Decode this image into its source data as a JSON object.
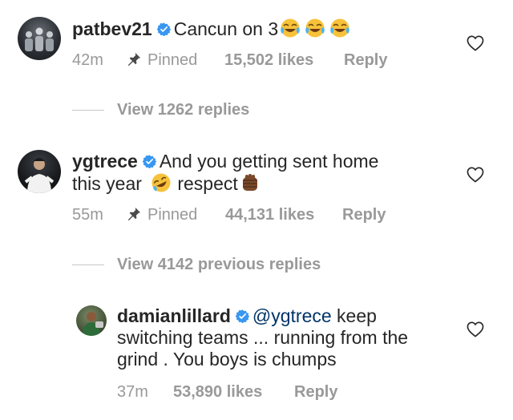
{
  "comments": [
    {
      "username": "patbev21",
      "text": "Cancun on 3",
      "emoji_after": "tears-of-joy-x3",
      "time": "42m",
      "pinned_label": "Pinned",
      "likes": "15,502 likes",
      "reply": "Reply"
    },
    {
      "username": "ygtrece",
      "text_line1": "And you getting sent home",
      "text_line2a": "this year",
      "text_line2b": "respect",
      "time": "55m",
      "pinned_label": "Pinned",
      "likes": "44,131 likes",
      "reply": "Reply"
    },
    {
      "username": "damianlillard",
      "mention": "@ygtrece",
      "text_line1": "keep",
      "text_line2": "switching teams ... running from the",
      "text_line3": "grind . You boys is chumps",
      "time": "37m",
      "likes": "53,890 likes",
      "reply": "Reply"
    }
  ],
  "view_replies_1": "View 1262 replies",
  "view_replies_2": "View 4142 previous replies",
  "colors": {
    "text": "#262626",
    "meta": "#999999",
    "verified": "#3897f0",
    "mention": "#003569"
  },
  "icons": [
    "verified-badge-icon",
    "pin-icon",
    "heart-icon",
    "tears-of-joy-emoji",
    "rofl-emoji",
    "raised-fist-emoji"
  ]
}
